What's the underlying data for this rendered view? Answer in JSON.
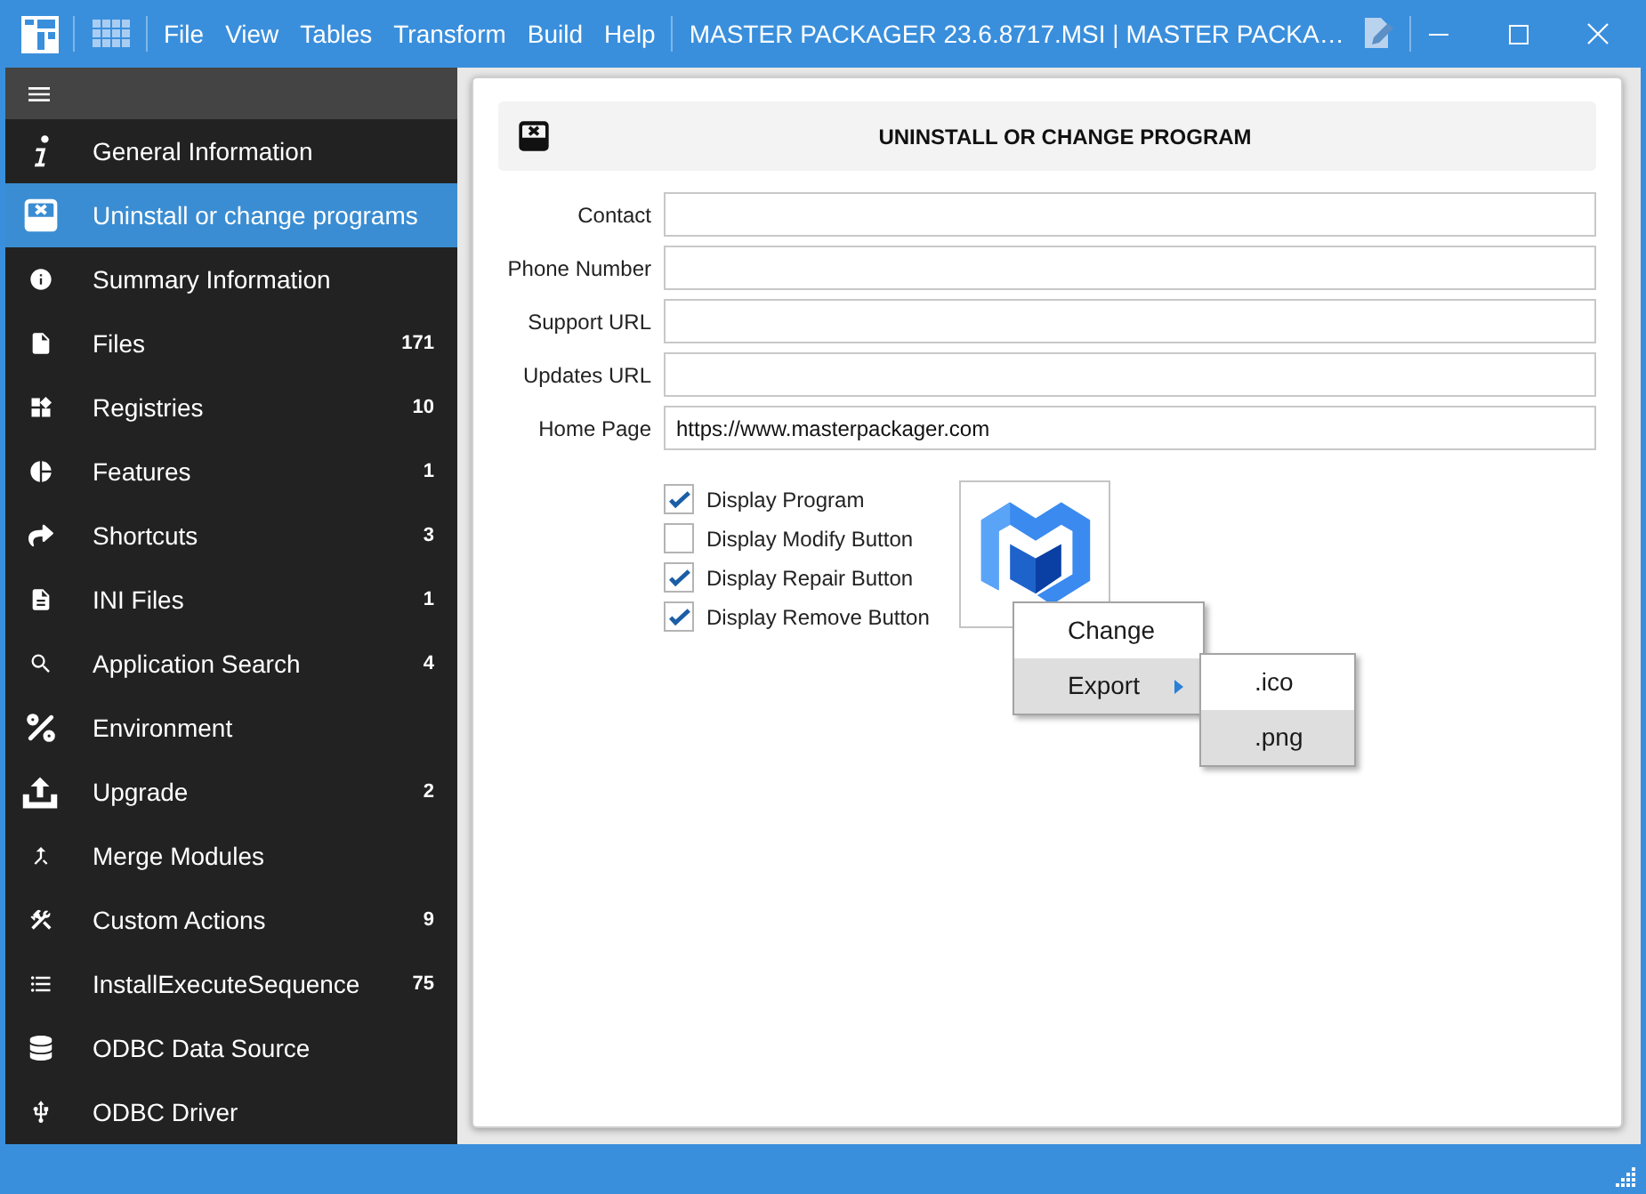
{
  "title_bar": {
    "menu": [
      "File",
      "View",
      "Tables",
      "Transform",
      "Build",
      "Help"
    ],
    "title": "MASTER PACKAGER 23.6.8717.MSI | MASTER PACKA…"
  },
  "sidebar": {
    "items": [
      {
        "label": "General Information",
        "selected": false
      },
      {
        "label": "Uninstall or change programs",
        "selected": true
      },
      {
        "label": "Summary Information",
        "selected": false
      },
      {
        "label": "Files",
        "count": "171",
        "selected": false
      },
      {
        "label": "Registries",
        "count": "10",
        "selected": false
      },
      {
        "label": "Features",
        "count": "1",
        "selected": false
      },
      {
        "label": "Shortcuts",
        "count": "3",
        "selected": false
      },
      {
        "label": "INI Files",
        "count": "1",
        "selected": false
      },
      {
        "label": "Application Search",
        "count": "4",
        "selected": false
      },
      {
        "label": "Environment",
        "selected": false
      },
      {
        "label": "Upgrade",
        "count": "2",
        "selected": false
      },
      {
        "label": "Merge Modules",
        "selected": false
      },
      {
        "label": "Custom Actions",
        "count": "9",
        "selected": false
      },
      {
        "label": "InstallExecuteSequence",
        "count": "75",
        "selected": false
      },
      {
        "label": "ODBC Data Source",
        "selected": false
      },
      {
        "label": "ODBC Driver",
        "selected": false
      }
    ]
  },
  "panel": {
    "title": "UNINSTALL OR CHANGE PROGRAM",
    "fields": [
      {
        "label": "Contact"
      },
      {
        "label": "Phone Number"
      },
      {
        "label": "Support URL"
      },
      {
        "label": "Updates URL"
      },
      {
        "label": "Home Page",
        "value": "https://www.masterpackager.com"
      }
    ],
    "checkboxes": [
      {
        "label": "Display Program",
        "checked": true
      },
      {
        "label": "Display Modify Button",
        "checked": false
      },
      {
        "label": "Display Repair Button",
        "checked": true
      },
      {
        "label": "Display Remove Button",
        "checked": true
      }
    ]
  },
  "context_menu": {
    "items": [
      {
        "label": "Change",
        "selected": false
      },
      {
        "label": "Export",
        "selected": true,
        "has_submenu": true
      }
    ],
    "submenu": {
      "items": [
        {
          "label": ".ico",
          "selected": false
        },
        {
          "label": ".png",
          "selected": true
        }
      ]
    }
  }
}
